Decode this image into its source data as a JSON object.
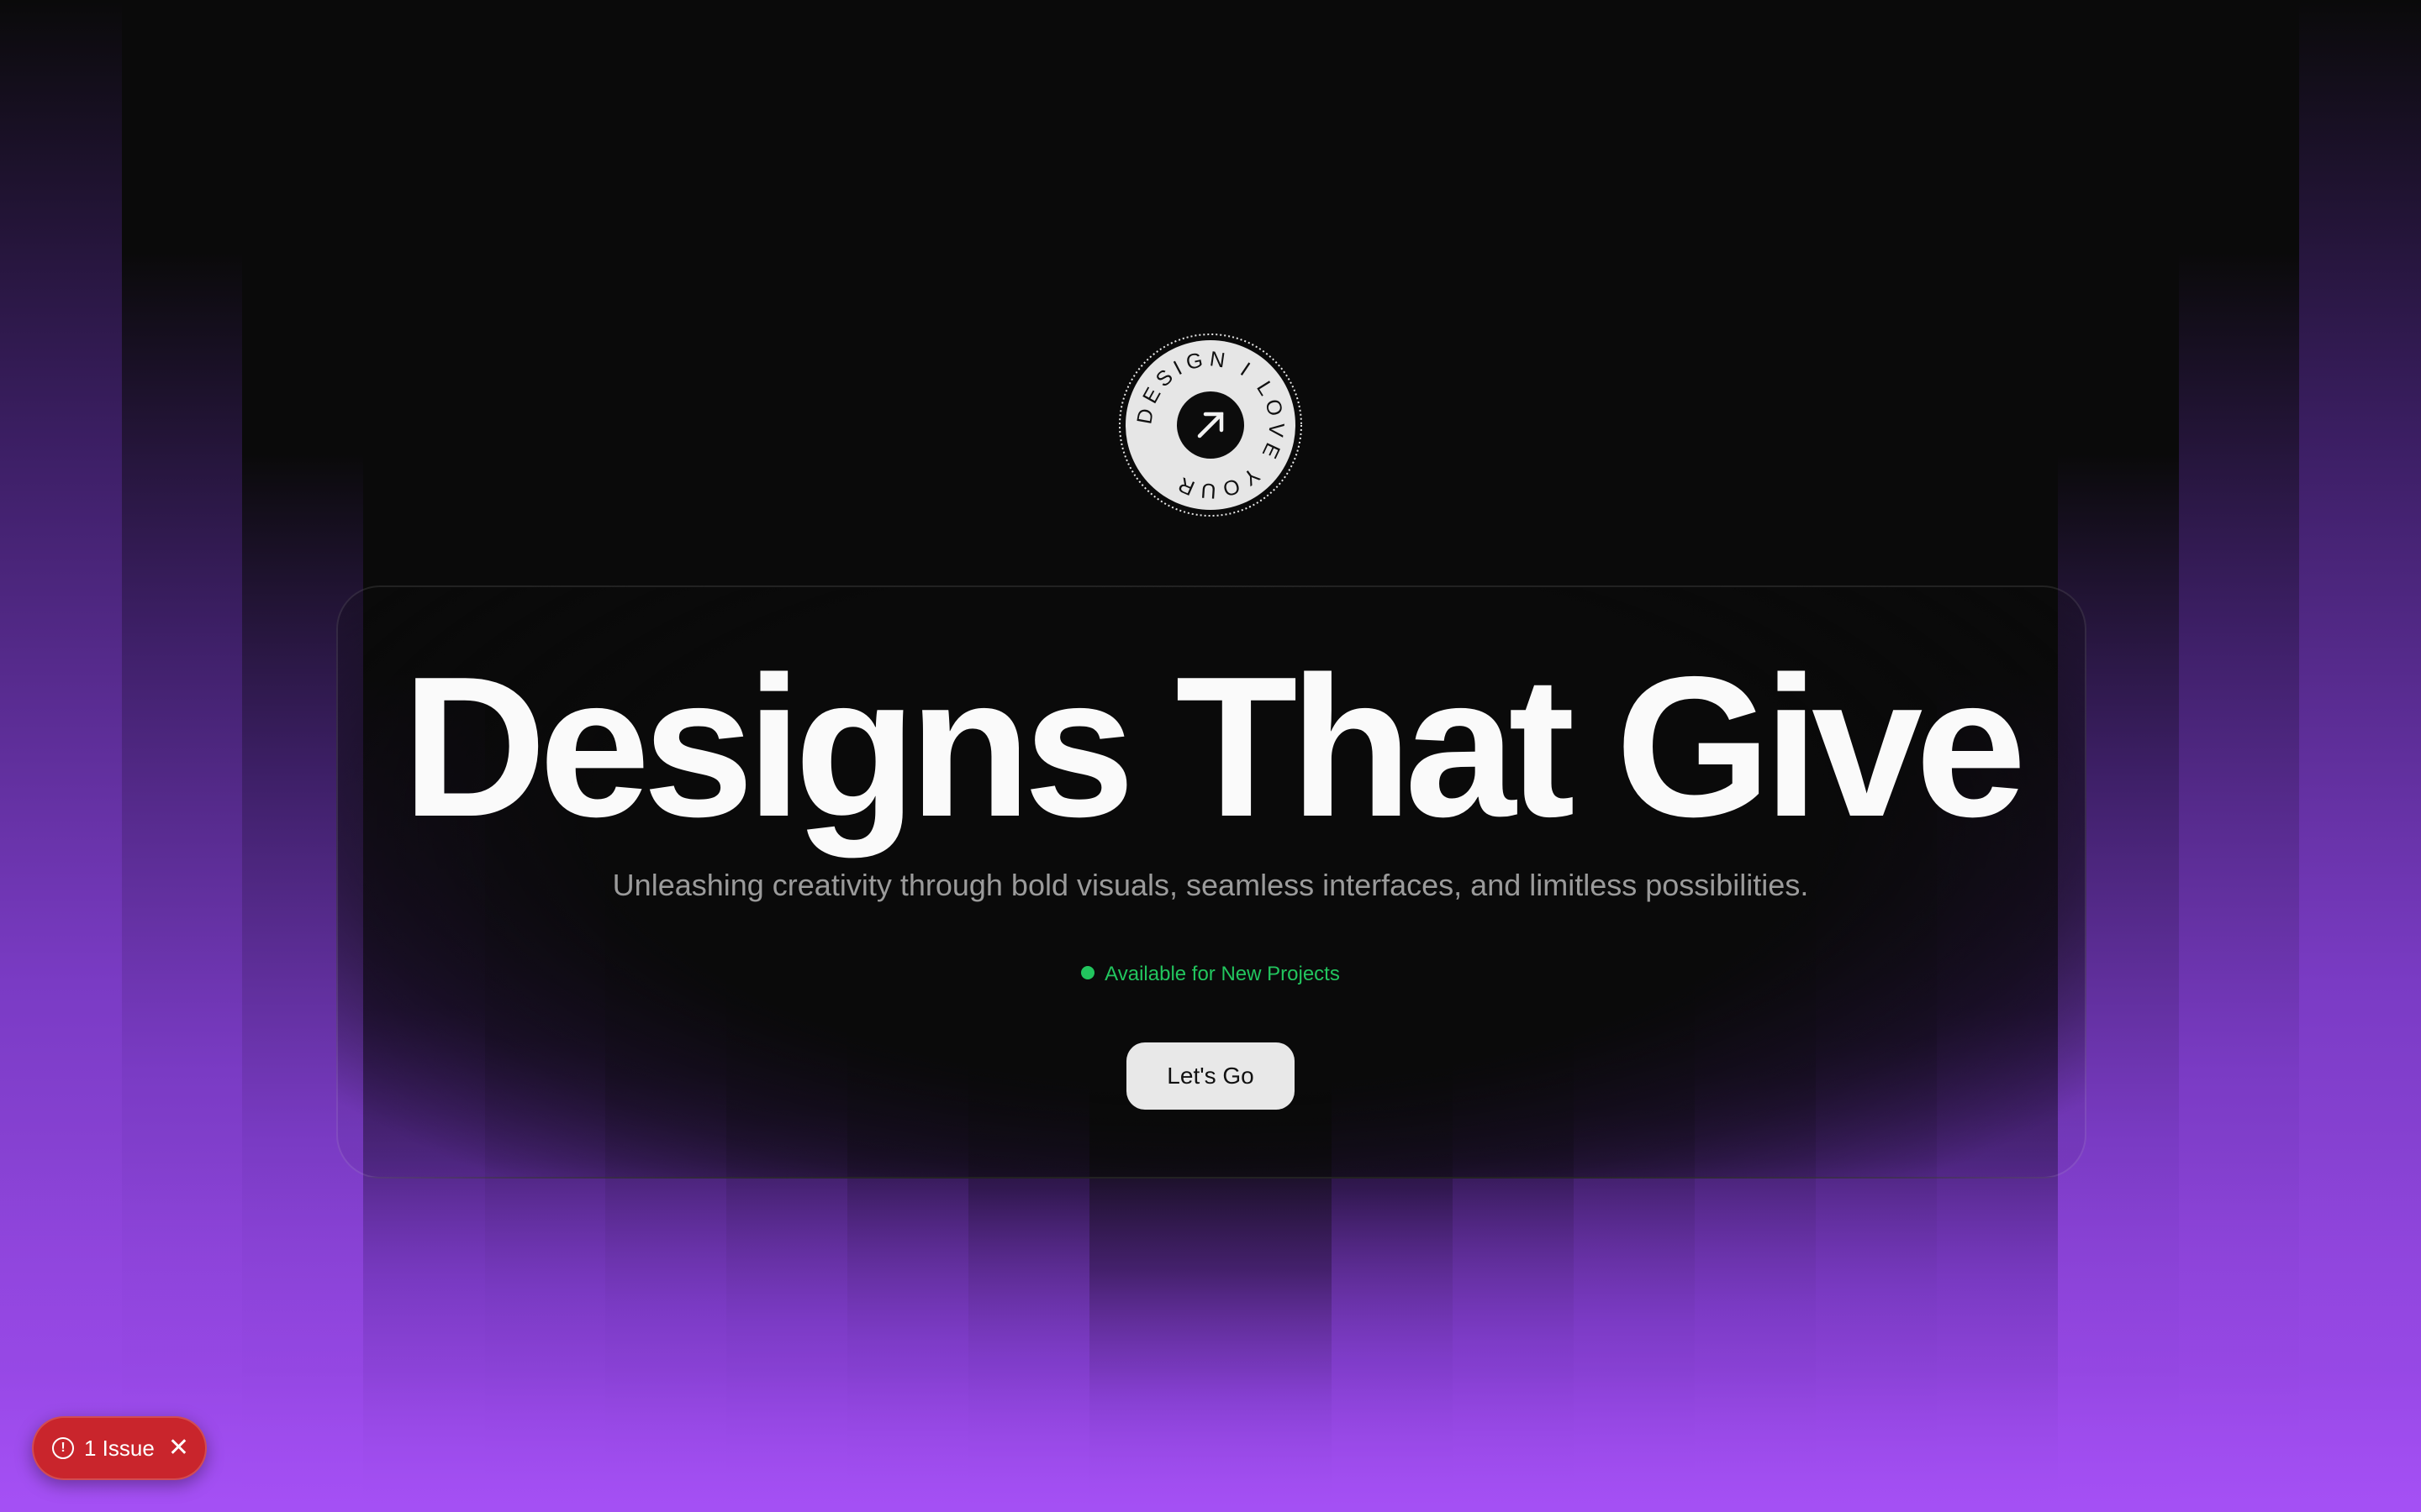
{
  "badge": {
    "ring_text": "DESIGN I LOVE YOUR",
    "icon": "arrow-up-right-icon"
  },
  "hero": {
    "title": "Designs That Give",
    "subtitle": "Unleashing creativity through bold visuals, seamless interfaces, and limitless possibilities.",
    "status": "Available for New Projects",
    "cta_label": "Let's Go"
  },
  "issue_toast": {
    "label": "1 Issue",
    "icon": "alert-circle-icon",
    "close_icon": "close-icon"
  },
  "colors": {
    "background": "#0a0a0a",
    "accent_purple": "#a24ff0",
    "status_green": "#22c55e",
    "issue_red": "#c9252c",
    "cta_bg": "#e8e8e8"
  }
}
